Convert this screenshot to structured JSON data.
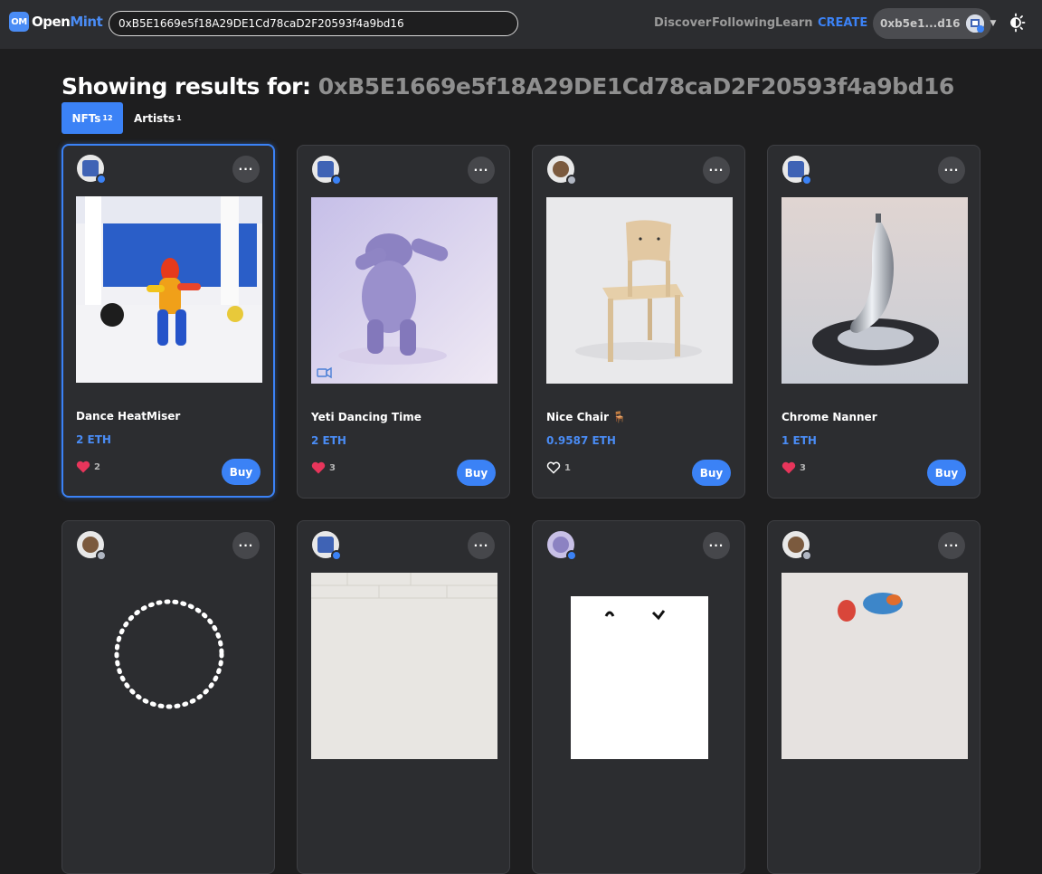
{
  "topbar": {
    "logo_badge": "OM",
    "logo_open": "Open",
    "logo_mint": "Mint",
    "search_value": "0xB5E1669e5f18A29DE1Cd78caD2F20593f4a9bd16",
    "nav": [
      "Discover",
      "Following",
      "Learn",
      "CREATE"
    ],
    "account_addr": "0xb5e1...d16",
    "theme_icon": "theme-toggle-icon"
  },
  "heading": {
    "prefix": "Showing results for:",
    "address": "0xB5E1669e5f18A29DE1Cd78caD2F20593f4a9bd16"
  },
  "tabs": {
    "nfts": {
      "label": "NFTs",
      "count": "12"
    },
    "artists": {
      "label": "Artists",
      "count": "1"
    }
  },
  "cards": [
    {
      "title": "Dance HeatMiser",
      "price": "2 ETH",
      "likes": "2",
      "liked": true,
      "buy": "Buy",
      "more": "···"
    },
    {
      "title": "Yeti Dancing Time",
      "price": "2 ETH",
      "likes": "3",
      "liked": true,
      "buy": "Buy",
      "more": "···"
    },
    {
      "title": "Nice Chair 🪑",
      "price": "0.9587 ETH",
      "likes": "1",
      "liked": false,
      "buy": "Buy",
      "more": "···"
    },
    {
      "title": "Chrome Nanner",
      "price": "1 ETH",
      "likes": "3",
      "liked": true,
      "buy": "Buy",
      "more": "···"
    },
    {
      "more": "···"
    },
    {
      "more": "···"
    },
    {
      "more": "···"
    },
    {
      "more": "···"
    }
  ],
  "colors": {
    "accent": "#3b82f6",
    "heart": "#e8355b",
    "background": "#1e1e1f",
    "card": "#2c2d30"
  }
}
